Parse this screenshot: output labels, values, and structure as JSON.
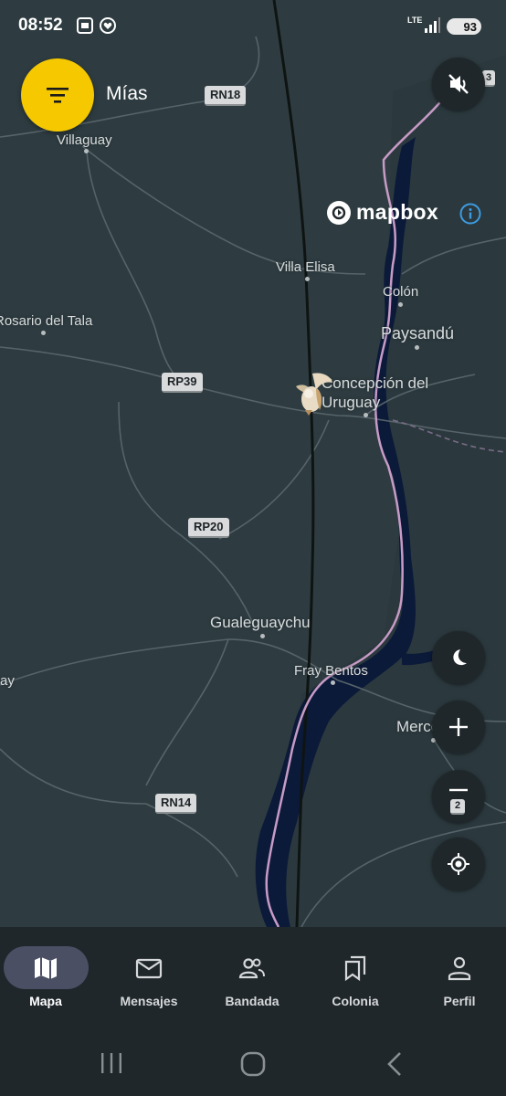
{
  "status": {
    "time": "08:52",
    "network": "LTE",
    "battery": "93"
  },
  "top": {
    "filter_label": "Mías"
  },
  "attribution": {
    "brand": "mapbox"
  },
  "map": {
    "places": [
      "Villaguay",
      "Villa Elisa",
      "Colón",
      "Rosario del Tala",
      "Paysandú",
      "Concepción del Uruguay",
      "Gualeguaychu",
      "Fray Bentos",
      "Mercedes",
      "ay"
    ],
    "shields": [
      "RN18",
      "RP39",
      "RP20",
      "RN14",
      "3"
    ],
    "zoom_badge": "2"
  },
  "nav": {
    "items": [
      {
        "label": "Mapa",
        "icon": "map-icon",
        "active": true
      },
      {
        "label": "Mensajes",
        "icon": "mail-icon"
      },
      {
        "label": "Bandada",
        "icon": "group-icon"
      },
      {
        "label": "Colonia",
        "icon": "bookmarks-icon"
      },
      {
        "label": "Perfil",
        "icon": "person-icon"
      }
    ]
  },
  "colors": {
    "accent": "#f5c800",
    "map_land": "#2e3c41",
    "river": "#0c1a3a",
    "border_line": "#c79bc6",
    "panel": "#1f272b"
  }
}
